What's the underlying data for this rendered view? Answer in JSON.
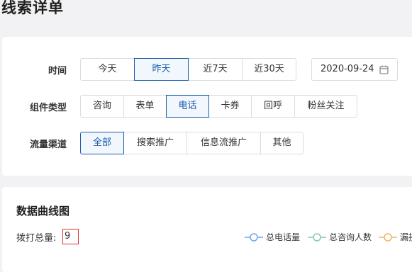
{
  "page_title": "线索详单",
  "filters": {
    "time": {
      "label": "时间",
      "options": [
        "今天",
        "昨天",
        "近7天",
        "近30天"
      ],
      "selected": "昨天"
    },
    "date_value": "2020-09-24",
    "component_type": {
      "label": "组件类型",
      "options": [
        "咨询",
        "表单",
        "电话",
        "卡券",
        "回呼",
        "粉丝关注"
      ],
      "selected": "电话"
    },
    "traffic_channel": {
      "label": "流量渠道",
      "options": [
        "全部",
        "搜索推广",
        "信息流推广",
        "其他"
      ],
      "selected": "全部"
    }
  },
  "chart_section": {
    "title": "数据曲线图",
    "total_label": "拨打总量:",
    "total_value": "9",
    "legend": [
      {
        "label": "总电话量",
        "color": "#6fa8e8"
      },
      {
        "label": "总咨询人数",
        "color": "#7fcab5"
      },
      {
        "label": "漏接",
        "color": "#f2b45c"
      }
    ]
  },
  "colors": {
    "accent": "#1a5dab",
    "highlight_border": "#e0322a"
  }
}
